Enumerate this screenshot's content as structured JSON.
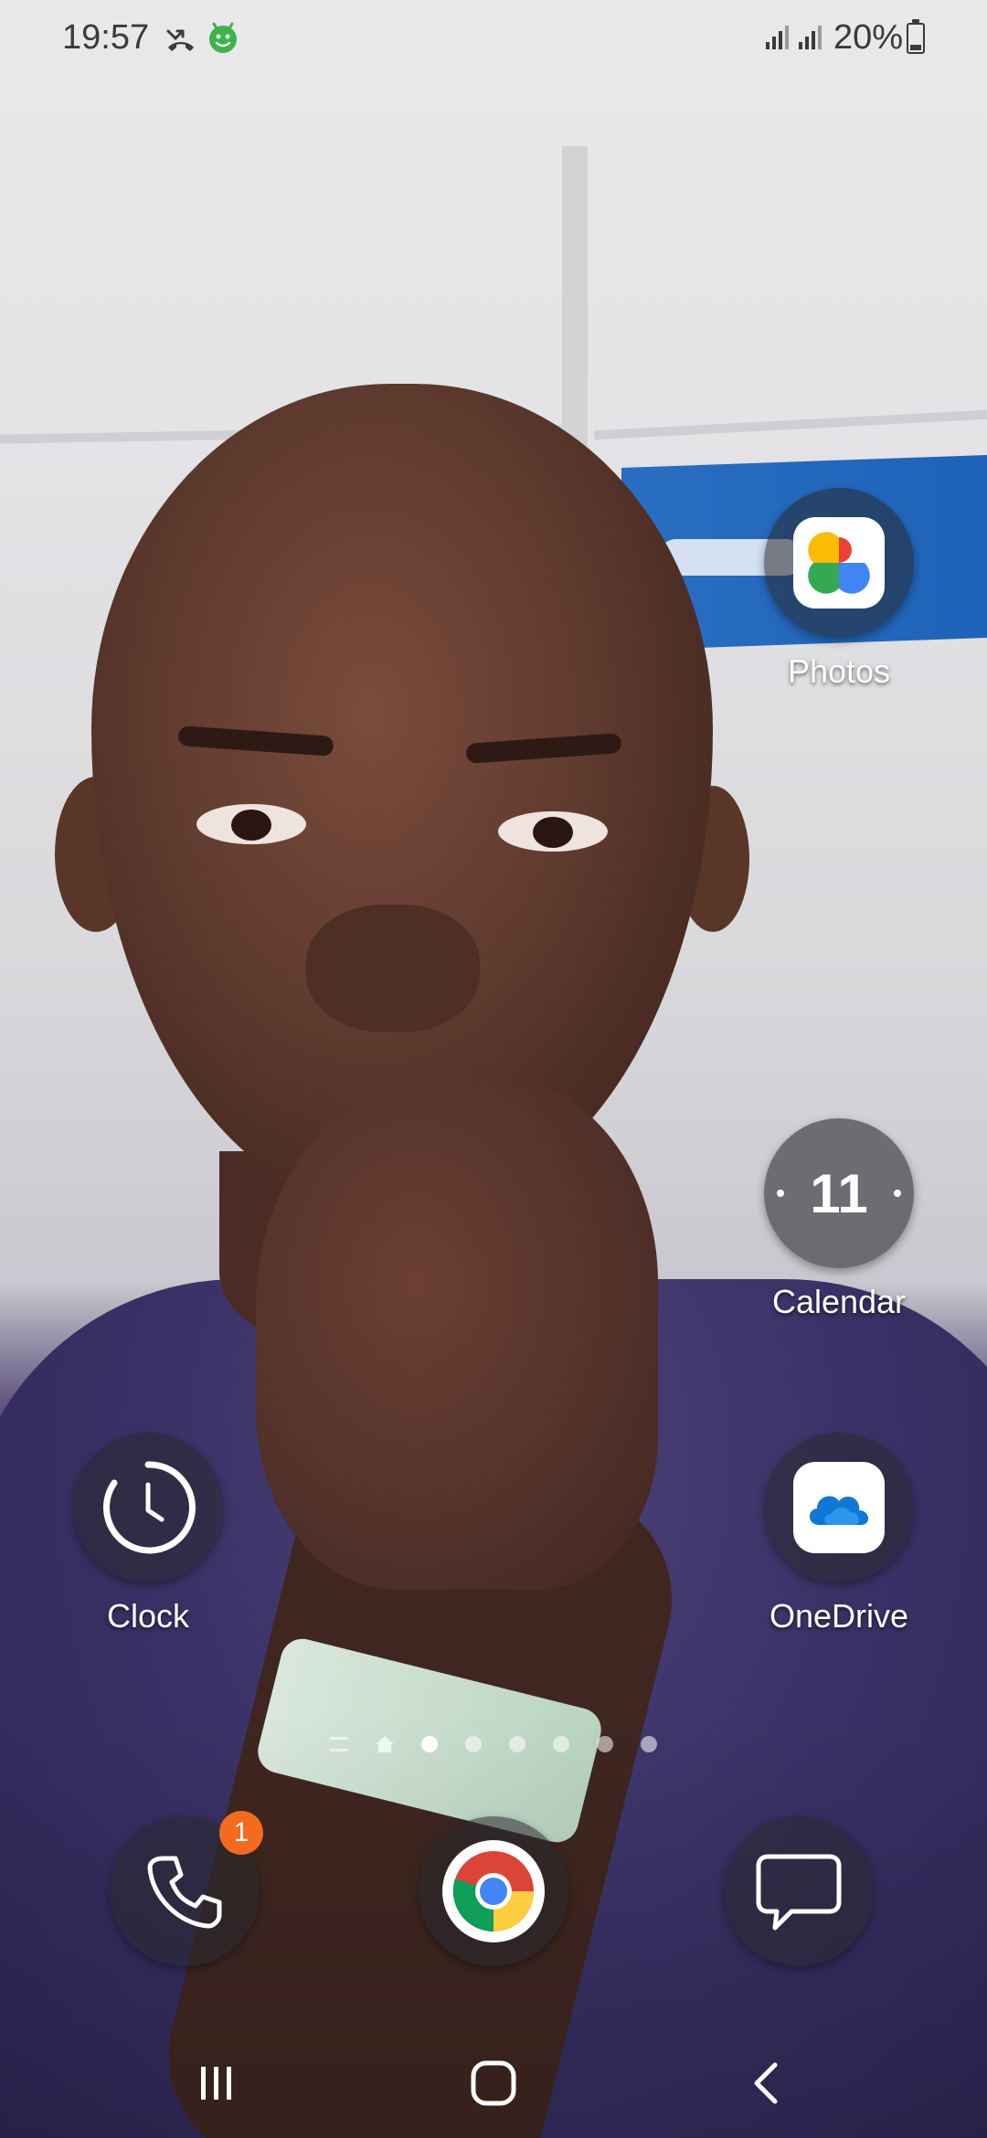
{
  "status_bar": {
    "time": "19:57",
    "battery_percent": "20%",
    "battery_level": 0.2,
    "icons": [
      "missed-call-icon",
      "android-icon",
      "signal-icon",
      "signal-icon",
      "battery-icon"
    ]
  },
  "home_apps": {
    "photos": {
      "label": "Photos",
      "icon": "google-photos-icon"
    },
    "calendar": {
      "label": "Calendar",
      "day": "11",
      "icon": "calendar-icon"
    },
    "clock": {
      "label": "Clock",
      "icon": "clock-icon"
    },
    "onedrive": {
      "label": "OneDrive",
      "icon": "onedrive-cloud-icon"
    }
  },
  "page_indicator": {
    "pages": 6,
    "active_page": 1,
    "icons": [
      "menu-icon",
      "home-icon"
    ]
  },
  "dock": {
    "phone": {
      "icon": "phone-icon",
      "badge": "1"
    },
    "chrome": {
      "icon": "chrome-icon"
    },
    "messages": {
      "icon": "messages-icon"
    }
  },
  "navigation": {
    "buttons": [
      "recents-button",
      "home-button",
      "back-button"
    ]
  },
  "colors": {
    "badge": "#f46a1f",
    "icon_background": "#28282e"
  }
}
